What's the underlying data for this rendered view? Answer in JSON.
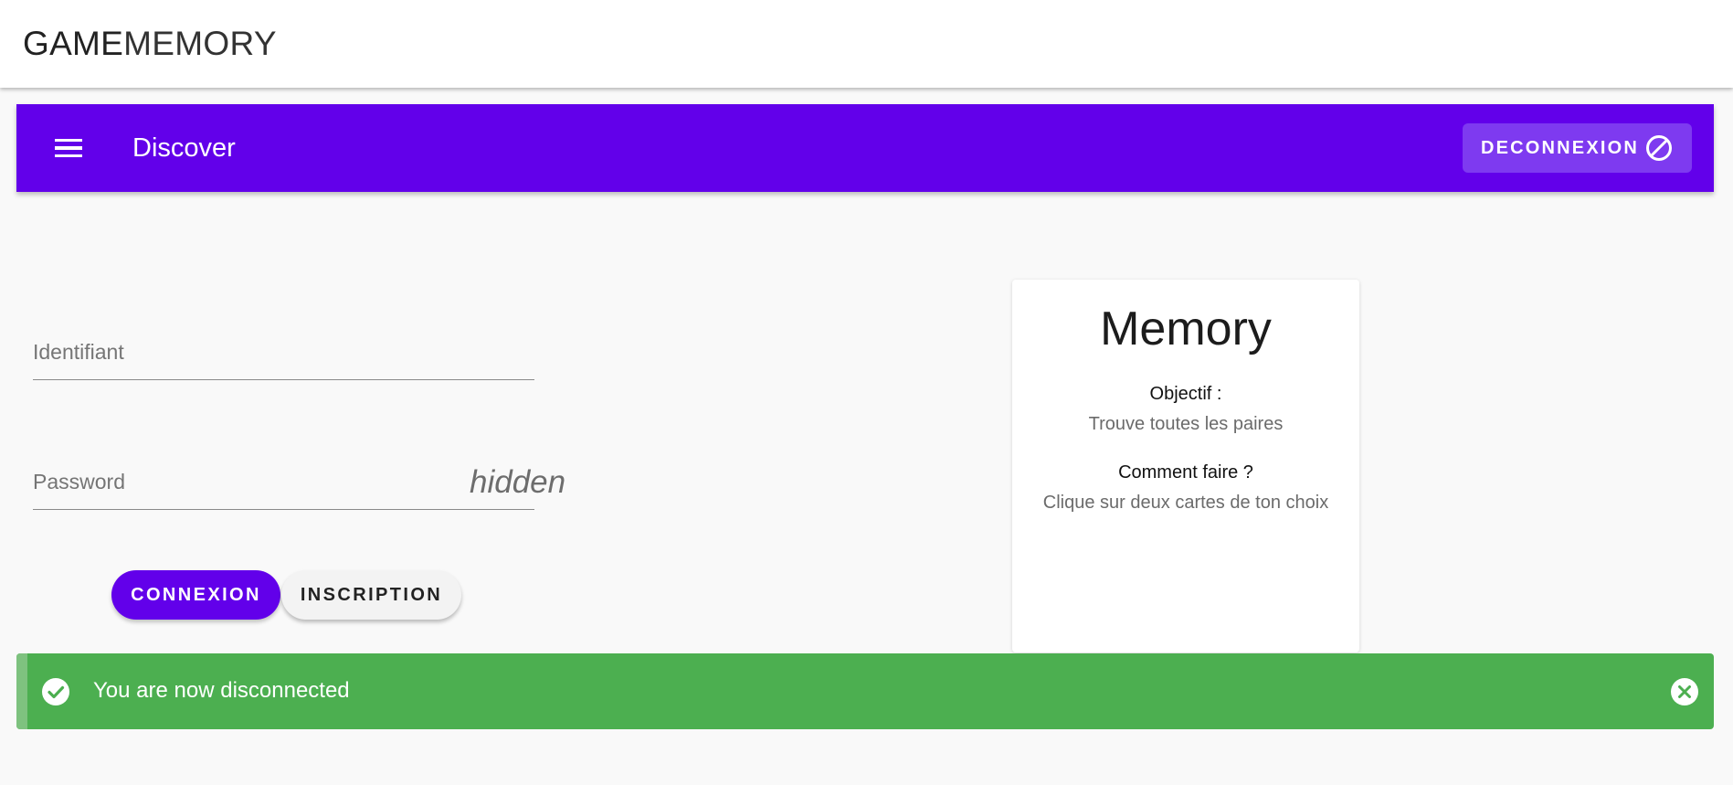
{
  "brand": {
    "part1": "GAME",
    "part2": "MEMORY"
  },
  "appbar": {
    "title": "Discover",
    "logout_label": "DECONNEXION"
  },
  "login_form": {
    "login_placeholder": "Identifiant",
    "password_placeholder": "Password",
    "password_toggle": "hidden",
    "connect_label": "CONNEXION",
    "register_label": "INSCRIPTION"
  },
  "info_card": {
    "title": "Memory",
    "objective_heading": "Objectif :",
    "objective_text": "Trouve toutes les paires",
    "howto_heading": "Comment faire ?",
    "howto_text": "Clique sur deux cartes de ton choix"
  },
  "alert": {
    "message": "You are now disconnected",
    "type": "success"
  },
  "icons": [
    "menu-icon",
    "block-icon",
    "check-circle-icon",
    "close-circle-icon"
  ],
  "colors": {
    "primary": "#6200ea",
    "success": "#4caf50",
    "logout_bg": "#7e3af0"
  }
}
